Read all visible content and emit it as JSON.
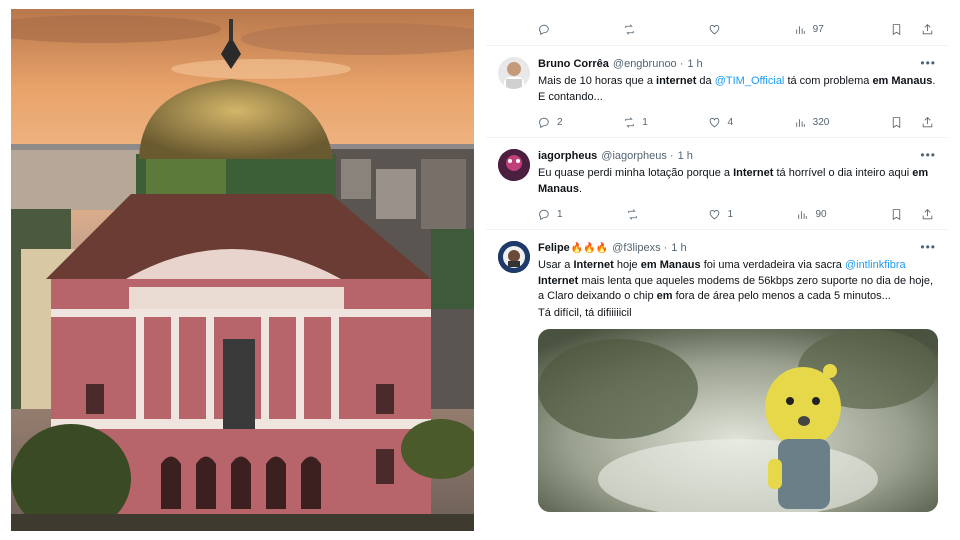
{
  "photo": {
    "alt_icon": "building-photo"
  },
  "top_actions": {
    "replies": "",
    "retweets": "",
    "likes": "",
    "views": "97"
  },
  "tweets": [
    {
      "name": "Bruno Corrêa",
      "handle": "@engbrunoo",
      "time": "1 h",
      "text_parts": [
        {
          "t": "Mais de 10 horas que a "
        },
        {
          "t": "internet",
          "b": true
        },
        {
          "t": " da "
        },
        {
          "t": "@TIM_Official",
          "m": true
        },
        {
          "t": " tá com problema "
        },
        {
          "t": "em Manaus",
          "b": true
        },
        {
          "t": ". E contando..."
        }
      ],
      "replies": "2",
      "retweets": "1",
      "likes": "4",
      "views": "320"
    },
    {
      "name": "iagorpheus",
      "handle": "@iagorpheus",
      "time": "1 h",
      "text_parts": [
        {
          "t": "Eu quase perdi minha lotação porque a "
        },
        {
          "t": "Internet",
          "b": true
        },
        {
          "t": " tá horrível o dia inteiro aqui "
        },
        {
          "t": "em Manaus",
          "b": true
        },
        {
          "t": "."
        }
      ],
      "replies": "1",
      "retweets": "",
      "likes": "1",
      "views": "90"
    },
    {
      "name": "Felipe",
      "name_emoji": "🔥🔥🔥",
      "handle": "@f3lipexs",
      "time": "1 h",
      "text_parts": [
        {
          "t": "Usar a "
        },
        {
          "t": "Internet",
          "b": true
        },
        {
          "t": " hoje "
        },
        {
          "t": "em Manaus",
          "b": true
        },
        {
          "t": " foi uma verdadeira via sacra "
        },
        {
          "t": "@intlinkfibra",
          "m": true
        },
        {
          "t": " "
        },
        {
          "t": "Internet",
          "b": true
        },
        {
          "t": " mais lenta que aqueles modems de 56kbps zero suporte no dia de hoje, a Claro deixando o chip "
        },
        {
          "t": "em",
          "b": true
        },
        {
          "t": " fora de área pelo menos a cada 5 minutos..."
        }
      ],
      "text2": "Tá difícil, tá difiiiiicil"
    }
  ],
  "icons": {
    "more": "more-icon",
    "reply": "reply-icon",
    "retweet": "retweet-icon",
    "like": "like-icon",
    "views": "views-icon",
    "bookmark": "bookmark-icon",
    "share": "share-icon"
  },
  "colors": {
    "mention": "#1d9bf0",
    "muted": "#536471"
  }
}
